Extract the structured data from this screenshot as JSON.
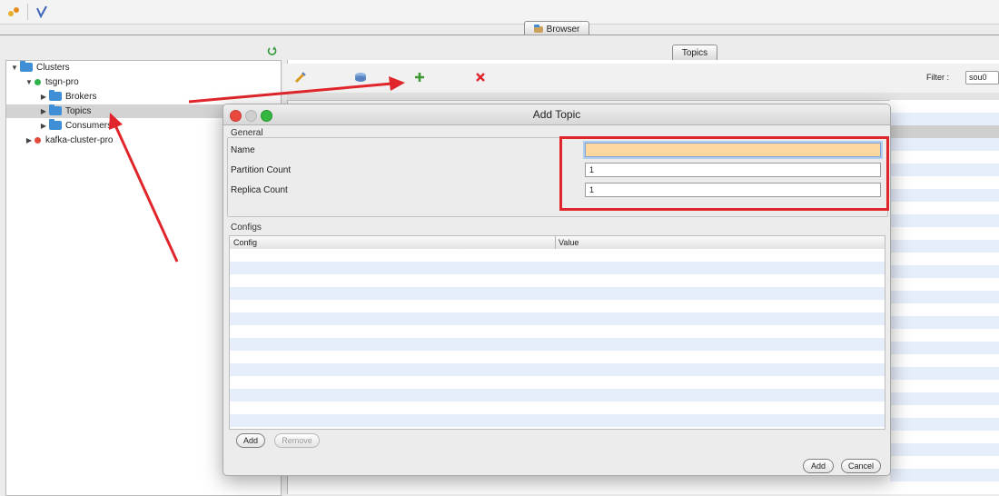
{
  "tabs": {
    "browser": "Browser",
    "topics": "Topics"
  },
  "tree": {
    "root": "Clusters",
    "cluster1": "tsgn-pro",
    "brokers": "Brokers",
    "topics": "Topics",
    "consumers": "Consumers",
    "cluster2": "kafka-cluster-pro"
  },
  "right_toolbar": {
    "filter_label": "Filter :",
    "filter_value": "sou0"
  },
  "dialog": {
    "title": "Add Topic",
    "general_label": "General",
    "name_label": "Name",
    "partition_label": "Partition Count",
    "replica_label": "Replica Count",
    "name_value": "",
    "partition_value": "1",
    "replica_value": "1",
    "configs_label": "Configs",
    "col_config": "Config",
    "col_value": "Value",
    "add_config_button": "Add",
    "remove_config_button": "Remove",
    "add_button": "Add",
    "cancel_button": "Cancel"
  },
  "colors": {
    "annotation_red": "#e0252b",
    "status_green": "#2fb24a",
    "status_red": "#e34a3b",
    "focused_field": "#fdd79e"
  },
  "icons": [
    "cluster-add-icon",
    "edit-icon",
    "refresh-icon",
    "add-icon",
    "delete-icon",
    "folder-icon"
  ]
}
